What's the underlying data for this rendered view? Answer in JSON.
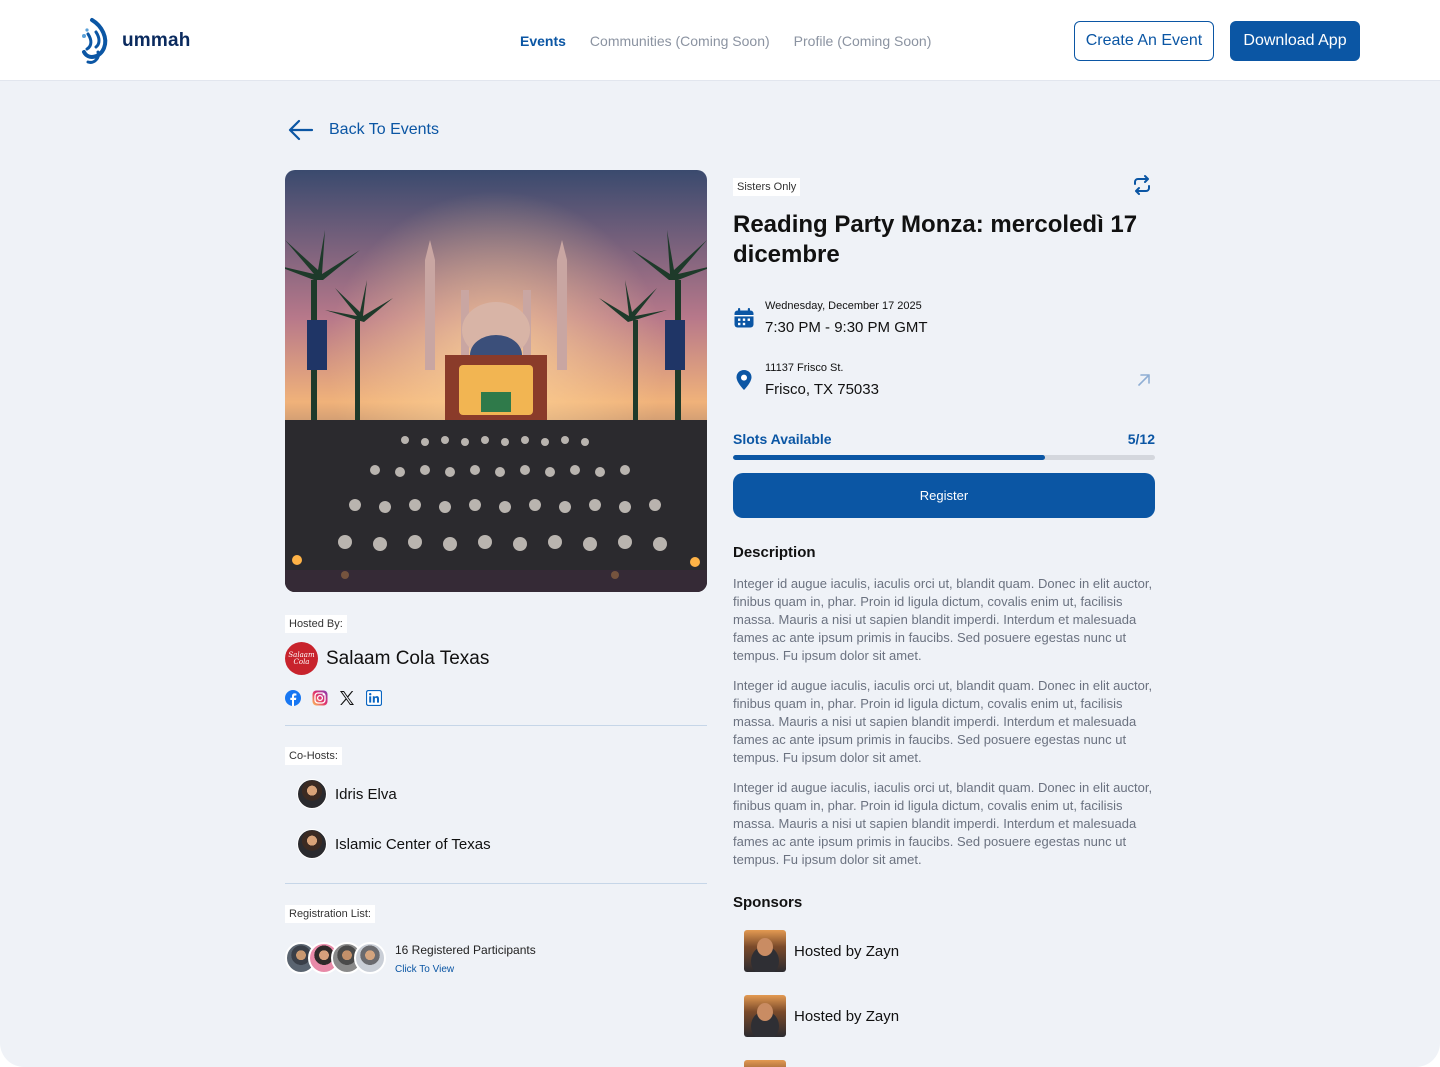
{
  "brand": {
    "name": "ummah",
    "color": "#0b56a4"
  },
  "nav": {
    "items": [
      {
        "label": "Events",
        "active": true
      },
      {
        "label": "Communities (Coming Soon)",
        "active": false
      },
      {
        "label": "Profile (Coming Soon)",
        "active": false
      }
    ]
  },
  "header": {
    "create_label": "Create An Event",
    "download_label": "Download App"
  },
  "back": {
    "label": "Back To Events",
    "icon": "arrow-left-icon"
  },
  "hosted": {
    "label": "Hosted By:",
    "name": "Salaam Cola Texas",
    "avatar_text": "Salaam Cola",
    "socials": [
      "facebook-icon",
      "instagram-icon",
      "x-icon",
      "linkedin-icon"
    ]
  },
  "cohosts": {
    "label": "Co-Hosts:",
    "items": [
      {
        "name": "Idris Elva"
      },
      {
        "name": "Islamic Center of Texas"
      }
    ]
  },
  "registration": {
    "label": "Registration List:",
    "count_text": "16 Registered Participants",
    "link": "Click To View"
  },
  "event": {
    "tag": "Sisters Only",
    "title": "Reading Party Monza: mercoledì 17 dicembre",
    "date": "Wednesday, December 17 2025",
    "time": "7:30 PM - 9:30 PM GMT",
    "address_line1": "11137 Frisco St.",
    "address_line2": "Frisco, TX 75033",
    "slots_label": "Slots Available",
    "slots_text": "5/12",
    "slots_fill": 0.74,
    "register_label": "Register"
  },
  "description": {
    "heading": "Description",
    "paragraphs": [
      "Integer id augue iaculis, iaculis orci ut, blandit quam. Donec in elit auctor, finibus quam in, phar. Proin id ligula dictum, covalis enim ut, facilisis massa. Mauris a nisi ut sapien blandit imperdi. Interdum et malesuada fames ac ante ipsum primis in faucibs. Sed posuere egestas nunc ut tempus. Fu ipsum dolor sit amet.",
      "Integer id augue iaculis, iaculis orci ut, blandit quam. Donec in elit auctor, finibus quam in, phar. Proin id ligula dictum, covalis enim ut, facilisis massa. Mauris a nisi ut sapien blandit imperdi. Interdum et malesuada fames ac ante ipsum primis in faucibs. Sed posuere egestas nunc ut tempus. Fu ipsum dolor sit amet.",
      "Integer id augue iaculis, iaculis orci ut, blandit quam. Donec in elit auctor, finibus quam in, phar. Proin id ligula dictum, covalis enim ut, facilisis massa. Mauris a nisi ut sapien blandit imperdi. Interdum et malesuada fames ac ante ipsum primis in faucibs. Sed posuere egestas nunc ut tempus. Fu ipsum dolor sit amet."
    ]
  },
  "sponsors": {
    "heading": "Sponsors",
    "items": [
      {
        "name": "Hosted by Zayn"
      },
      {
        "name": "Hosted by Zayn"
      }
    ]
  }
}
